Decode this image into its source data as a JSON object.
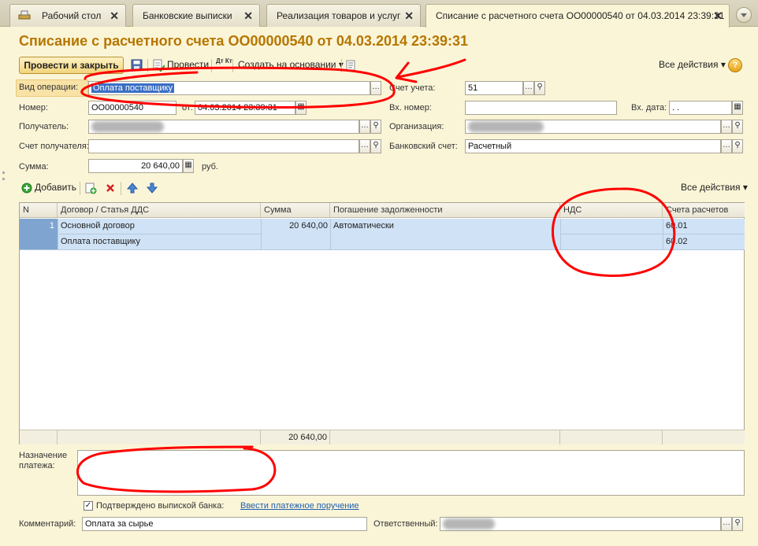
{
  "tabs": [
    {
      "label": "Рабочий стол"
    },
    {
      "label": "Банковские выписки"
    },
    {
      "label": "Реализация товаров и услуг"
    },
    {
      "label": "Списание с расчетного счета ОО00000540 от 04.03.2014 23:39:31"
    }
  ],
  "tab_close": "✕",
  "title": "Списание с расчетного счета ОО00000540 от 04.03.2014 23:39:31",
  "toolbar": {
    "post_close": "Провести и закрыть",
    "post": "Провести",
    "create_based": "Создать на основании",
    "all_actions": "Все действия",
    "help": "?",
    "dt_kt": "Дт Кт"
  },
  "form": {
    "operation_label": "Вид операции:",
    "operation_value": "Оплата поставщику",
    "account_label": "Счет учета:",
    "account_value": "51",
    "number_label": "Номер:",
    "number_value": "ОО00000540",
    "from_label": "от:",
    "from_value": "04.03.2014 23:39:31",
    "in_number_label": "Вх. номер:",
    "in_number_value": "",
    "in_date_label": "Вх. дата:",
    "in_date_value": " .  .",
    "recipient_label": "Получатель:",
    "org_label": "Организация:",
    "recipient_account_label": "Счет получателя:",
    "bank_account_label": "Банковский счет:",
    "bank_account_value": "Расчетный",
    "sum_label": "Сумма:",
    "sum_value": "20 640,00",
    "currency": "руб."
  },
  "table_toolbar": {
    "add": "Добавить",
    "all_actions": "Все действия"
  },
  "table": {
    "columns": [
      "N",
      "Договор / Статья ДДС",
      "Сумма",
      "Погашение задолженности",
      "НДС",
      "Счета расчетов"
    ],
    "row": {
      "n": "1",
      "contract": "Основной договор",
      "article": "Оплата поставщику",
      "sum": "20 640,00",
      "repayment": "Автоматически",
      "vat": "",
      "account1": "60.01",
      "account2": "60.02"
    },
    "total": "20 640,00"
  },
  "bottom": {
    "purpose_label": "Назначение\nплатежа:",
    "confirmed_label": "Подтверждено выпиской банка:",
    "confirmed_check": "✓",
    "enter_order_link": "Ввести платежное поручение",
    "comment_label": "Комментарий:",
    "comment_value": "Оплата за сырье",
    "responsible_label": "Ответственный:"
  },
  "icons": {
    "select": "…",
    "search": "⚲",
    "calendar": "▦",
    "dropdown": "▾"
  }
}
